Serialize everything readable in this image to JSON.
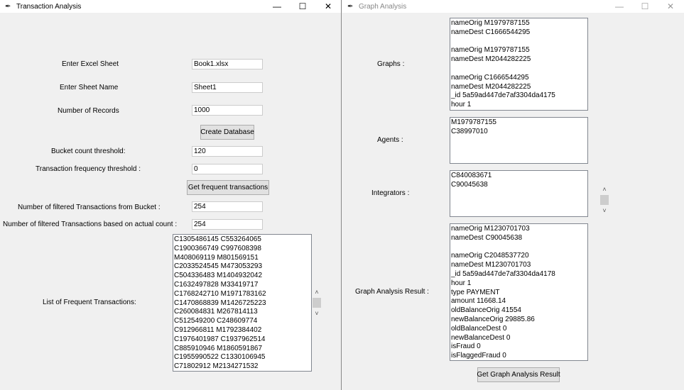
{
  "left_window": {
    "title": "Transaction Analysis",
    "labels": {
      "excel": "Enter Excel Sheet",
      "sheet": "Enter Sheet Name",
      "records": "Number of Records",
      "bucket": "Bucket count threshold:",
      "freq": "Transaction frequency threshold :",
      "filtered_bucket": "Number of filtered Transactions from Bucket :",
      "filtered_actual": "Number of filtered Transactions based on actual count :",
      "list": "List of Frequent Transactions:"
    },
    "values": {
      "excel": "Book1.xlsx",
      "sheet": "Sheet1",
      "records": "1000",
      "bucket": "120",
      "freq": "0",
      "filtered_bucket": "254",
      "filtered_actual": "254"
    },
    "buttons": {
      "create": "Create Database",
      "get_frequent": "Get frequent transactions"
    },
    "frequent_transactions": [
      "C1305486145 C553264065",
      "C1900366749 C997608398",
      "M408069119 M801569151",
      "C2033524545 M473053293",
      "C504336483 M1404932042",
      "C1632497828 M33419717",
      "C1768242710 M1971783162",
      "C1470868839 M1426725223",
      "C260084831 M267814113",
      "C512549200 C248609774",
      "C912966811 M1792384402",
      "C1976401987 C1937962514",
      "C885910946 M1860591867",
      "C1955990522 C1330106945",
      "C71802912 M2134271532"
    ]
  },
  "right_window": {
    "title": "Graph Analysis",
    "labels": {
      "graphs": "Graphs :",
      "agents": "Agents :",
      "integrators": "Integrators :",
      "result": "Graph Analysis Result :"
    },
    "graphs": [
      "nameOrig M1979787155",
      "nameDest C1666544295",
      "",
      "nameOrig M1979787155",
      "nameDest M2044282225",
      "",
      "nameOrig C1666544295",
      "nameDest M2044282225",
      "_id 5a59ad447de7af3304da4175",
      "hour 1"
    ],
    "agents": [
      "M1979787155",
      "C38997010"
    ],
    "integrators": [
      "C840083671",
      "C90045638"
    ],
    "result": [
      "nameOrig M1230701703",
      "nameDest C90045638",
      "",
      "nameOrig C2048537720",
      "nameDest M1230701703",
      "_id 5a59ad447de7af3304da4178",
      "hour 1",
      "type PAYMENT",
      "amount 11668.14",
      "oldBalanceOrig 41554",
      "newBalanceOrig 29885.86",
      "oldBalanceDest 0",
      "newBalanceDest 0",
      "isFraud 0",
      "isFlaggedFraud 0"
    ],
    "buttons": {
      "get_result": "Get Graph Analysis Result"
    }
  }
}
